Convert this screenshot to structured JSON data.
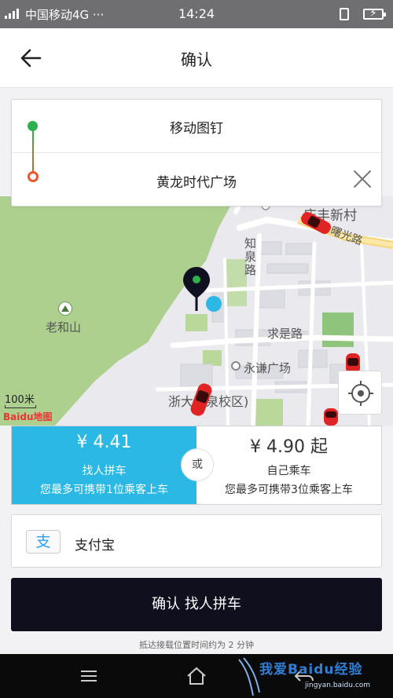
{
  "status_bar": {
    "carrier": "中国移动4G ···",
    "time": "14:24",
    "icons": [
      "signal-icon",
      "vibrate-icon",
      "battery-charging-icon"
    ]
  },
  "header": {
    "title": "确认",
    "back_icon": "arrow-left-icon"
  },
  "route": {
    "start": "移动图钉",
    "destination": "黄龙时代广场",
    "clear_icon": "close-icon"
  },
  "map": {
    "labels": {
      "mountain": "老和山",
      "road_vertical": "知泉路",
      "road_horizontal": "求是路",
      "plaza": "永谦广场",
      "campus": "浙大玉泉校区)",
      "village": "庆丰新村",
      "road_ne": "曙光路"
    },
    "scale": "100米",
    "logo": "Baidu地图",
    "locate_icon": "crosshair-icon",
    "pin_icon": "map-pin-icon"
  },
  "options": {
    "pool": {
      "price": "¥ 4.41",
      "name": "找人拼车",
      "desc": "您最多可携带1位乘客上车",
      "selected": true
    },
    "or_label": "或",
    "solo": {
      "price": "¥ 4.90 起",
      "name": "自己乘车",
      "desc": "您最多可携带3位乘客上车",
      "selected": false
    }
  },
  "payment": {
    "label": "支付宝",
    "icon_glyph": "支"
  },
  "confirm_label": "确认 找人拼车",
  "note": "抵达接载位置时间约为 2 分钟",
  "watermark": {
    "line1": "我爱Baidu经验",
    "line2": "jingyan.baidu.com"
  },
  "colors": {
    "accent": "#2cb8e5",
    "confirm_bg": "#0f0f1e",
    "start_dot": "#2bb24c",
    "end_dot": "#f0562a",
    "car": "#e02424",
    "park": "#aed08e"
  }
}
